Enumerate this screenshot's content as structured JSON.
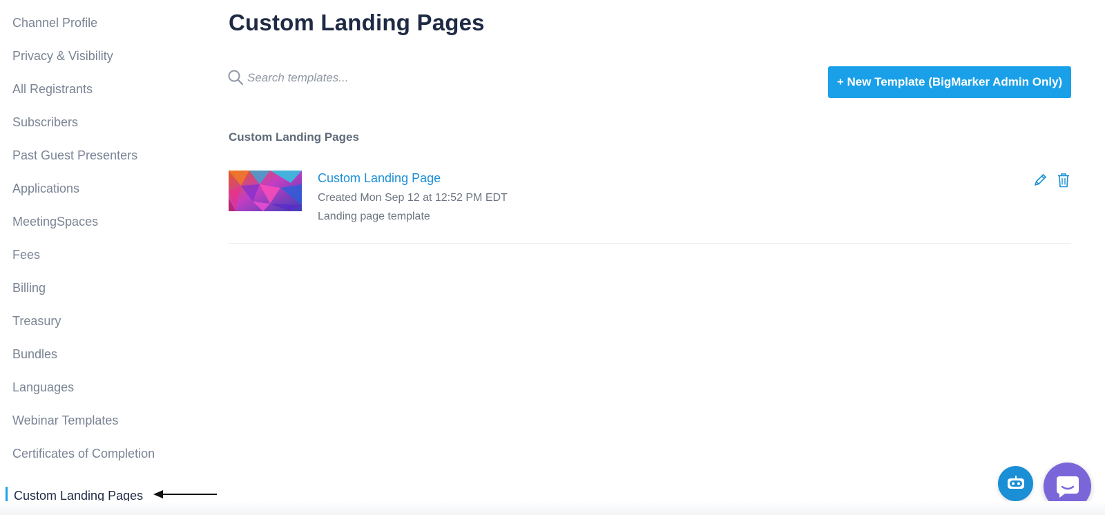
{
  "sidebar": {
    "items": [
      {
        "label": "Channel Profile"
      },
      {
        "label": "Privacy & Visibility"
      },
      {
        "label": "All Registrants"
      },
      {
        "label": "Subscribers"
      },
      {
        "label": "Past Guest Presenters"
      },
      {
        "label": "Applications"
      },
      {
        "label": "MeetingSpaces"
      },
      {
        "label": "Fees"
      },
      {
        "label": "Billing"
      },
      {
        "label": "Treasury"
      },
      {
        "label": "Bundles"
      },
      {
        "label": "Languages"
      },
      {
        "label": "Webinar Templates"
      },
      {
        "label": "Certificates of Completion"
      },
      {
        "label": "Custom Landing Pages",
        "active": true
      }
    ]
  },
  "main": {
    "title": "Custom Landing Pages",
    "search": {
      "placeholder": "Search templates...",
      "value": ""
    },
    "new_template_label": "+ New Template (BigMarker Admin Only)",
    "section_heading": "Custom Landing Pages",
    "templates": [
      {
        "name": "Custom Landing Page",
        "created": "Created Mon Sep 12 at 12:52 PM EDT",
        "description": "Landing page template"
      }
    ]
  },
  "icons": {
    "search": "search-icon",
    "edit": "pencil-icon",
    "delete": "trash-icon",
    "assistant": "bot-icon",
    "chat": "chat-bubble-icon"
  },
  "colors": {
    "accent": "#1aa0e8",
    "link": "#1a8fd6",
    "chat": "#7b66d9",
    "title": "#1e2a44"
  }
}
